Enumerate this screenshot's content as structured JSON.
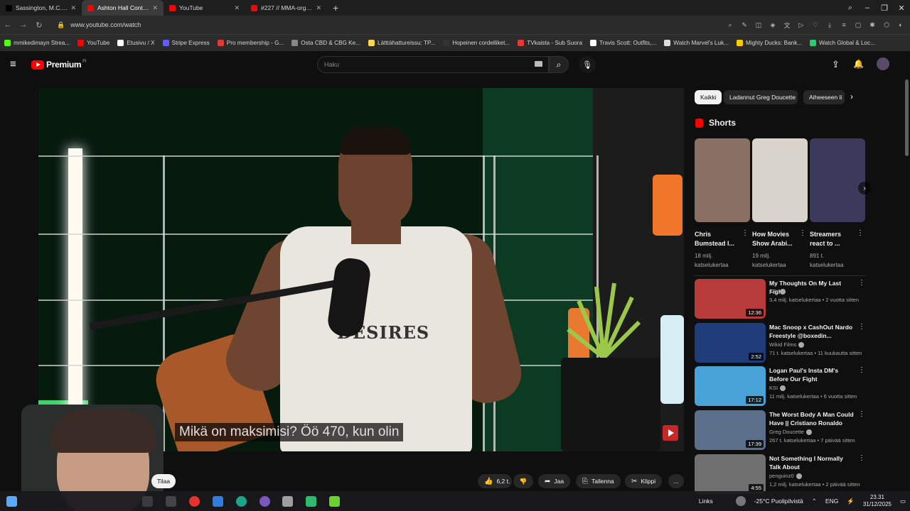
{
  "browser": {
    "tabs": [
      {
        "label": "Sassington, M.C. Xssid",
        "icon_color": "#000000",
        "active": false
      },
      {
        "label": "Ashton Hall Continue",
        "icon_color": "#ff0000",
        "active": true
      },
      {
        "label": "YouTube",
        "icon_color": "#ff0000",
        "active": false
      },
      {
        "label": "#227 // MMA-organisaat",
        "icon_color": "#ff0000",
        "active": false
      }
    ],
    "url": "www.youtube.com/watch",
    "bookmarks": [
      {
        "label": "mmikedimayn Strea...",
        "color": "#53fc18"
      },
      {
        "label": "YouTube",
        "color": "#ff0000"
      },
      {
        "label": "Etusivu / X",
        "color": "#ffffff"
      },
      {
        "label": "Stripe Express",
        "color": "#635bff"
      },
      {
        "label": "Pro membership - G...",
        "color": "#e53935"
      },
      {
        "label": "Osta CBD & CBG Ke...",
        "color": "#888888"
      },
      {
        "label": "Lätttähattureissu: TP...",
        "color": "#ffd54f"
      },
      {
        "label": "Hopeinen cordelliket...",
        "color": "#333333"
      },
      {
        "label": "TVkaista - Sub Suora",
        "color": "#e53935"
      },
      {
        "label": "Travis Scott: Outfits,...",
        "color": "#ffffff"
      },
      {
        "label": "Watch Marvel's Luk...",
        "color": "#dddddd"
      },
      {
        "label": "Mighty Ducks: Bank...",
        "color": "#ffcc00"
      },
      {
        "label": "Watch Global & Loc...",
        "color": "#2ecc71"
      }
    ]
  },
  "youtube": {
    "logo_text": "Premium",
    "logo_sup": "FI",
    "search_placeholder": "Haku",
    "player": {
      "subtitle": "Mikä on maksimisi? Öö 470, kun olin",
      "shirt_print": "DESIRES"
    },
    "subscribe_label": "Tilaa",
    "actions": {
      "likes": "6,2 t.",
      "share": "Jaa",
      "save": "Tallenna",
      "clip": "Klippi",
      "more": "..."
    },
    "chips": [
      "Kaikki",
      "Ladannut Greg Doucette",
      "Aiheeseen li"
    ],
    "shorts_title": "Shorts",
    "shorts": [
      {
        "title": "Chris Bumstead I...",
        "views": "18 milj. katselukertaa",
        "color": "#8a7062"
      },
      {
        "title": "How Movies Show Arabi...",
        "views": "19 milj. katselukertaa",
        "color": "#d9d4cb"
      },
      {
        "title": "Streamers react to ...",
        "views": "891 t. katselukertaa",
        "color": "#3b3a5c"
      }
    ],
    "recommended": [
      {
        "title": "My Thoughts On My Last Fight",
        "channel": "KSI",
        "meta": "3,4 milj. katselukertaa • 2 vuotta sitten",
        "duration": "12:36",
        "color": "#b83b3b"
      },
      {
        "title": "Mac Snoop x CashOut Nardo Freestyle @boxedin...",
        "channel": "Wikid Films",
        "meta": "71 t. katselukertaa • 11 kuukautta sitten",
        "duration": "2:52",
        "color": "#1f3d7a"
      },
      {
        "title": "Logan Paul's Insta DM's Before Our Fight",
        "channel": "KSI",
        "meta": "11 milj. katselukertaa • 6 vuotta sitten",
        "duration": "17:12",
        "color": "#4aa3d8"
      },
      {
        "title": "The Worst Body A Man Could Have || Cristiano Ronaldo",
        "channel": "Greg Doucette",
        "meta": "267 t. katselukertaa • 7 päivää sitten",
        "duration": "17:39",
        "color": "#5b6f8a"
      },
      {
        "title": "Not Something I Normally Talk About",
        "channel": "penguinz0",
        "meta": "1,2 milj. katselukertaa • 2 päivää sitten",
        "duration": "4:55",
        "color": "#6f6f6f"
      }
    ]
  },
  "taskbar": {
    "links": "Links",
    "weather": "-25°C Puolipilvistä",
    "lang": "ENG",
    "time": "23.31",
    "date": "31/12/2025"
  }
}
